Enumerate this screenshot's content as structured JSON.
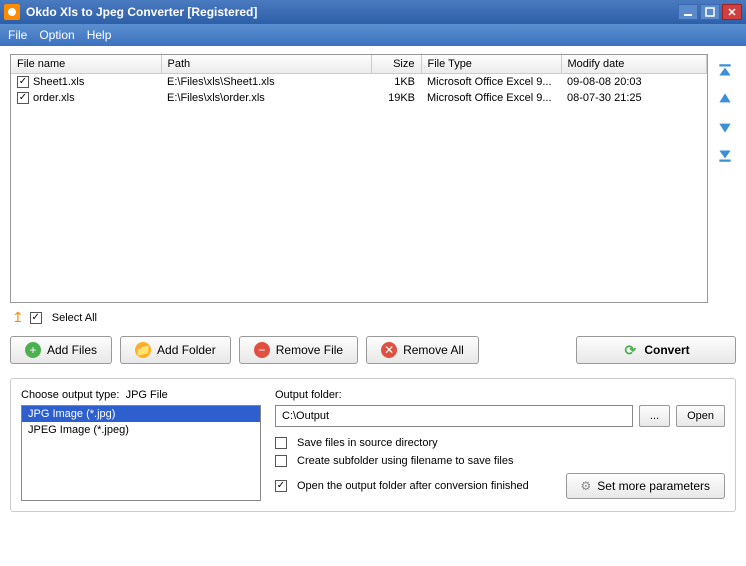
{
  "window": {
    "title": "Okdo Xls to Jpeg Converter [Registered]"
  },
  "menu": {
    "file": "File",
    "option": "Option",
    "help": "Help"
  },
  "table": {
    "headers": {
      "name": "File name",
      "path": "Path",
      "size": "Size",
      "type": "File Type",
      "modify": "Modify date"
    },
    "rows": [
      {
        "checked": true,
        "name": "Sheet1.xls",
        "path": "E:\\Files\\xls\\Sheet1.xls",
        "size": "1KB",
        "type": "Microsoft Office Excel 9...",
        "modify": "09-08-08 20:03"
      },
      {
        "checked": true,
        "name": "order.xls",
        "path": "E:\\Files\\xls\\order.xls",
        "size": "19KB",
        "type": "Microsoft Office Excel 9...",
        "modify": "08-07-30 21:25"
      }
    ]
  },
  "selectall": {
    "label": "Select All",
    "checked": true
  },
  "buttons": {
    "addfiles": "Add Files",
    "addfolder": "Add Folder",
    "removefile": "Remove File",
    "removeall": "Remove All",
    "convert": "Convert"
  },
  "output": {
    "typelabel": "Choose output type:",
    "typename": "JPG File",
    "types": [
      {
        "label": "JPG Image (*.jpg)",
        "selected": true
      },
      {
        "label": "JPEG Image (*.jpeg)",
        "selected": false
      }
    ],
    "folderlabel": "Output folder:",
    "folderpath": "C:\\Output",
    "browse": "...",
    "open": "Open",
    "opt_save_source": {
      "label": "Save files in source directory",
      "checked": false
    },
    "opt_subfolder": {
      "label": "Create subfolder using filename to save files",
      "checked": false
    },
    "opt_openafter": {
      "label": "Open the output folder after conversion finished",
      "checked": true
    },
    "moreparams": "Set more parameters"
  }
}
